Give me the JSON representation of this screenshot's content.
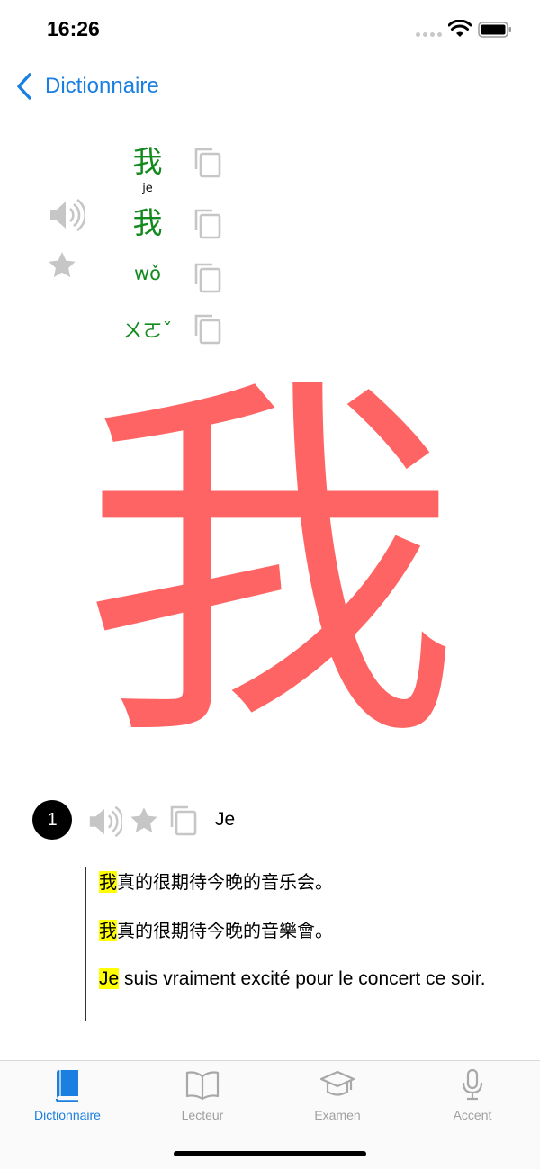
{
  "status_bar": {
    "time": "16:26"
  },
  "nav": {
    "back_label": "Dictionnaire"
  },
  "headword": {
    "simplified": "我",
    "gloss_small": "je",
    "traditional": "我",
    "pinyin": "wǒ",
    "zhuyin": "ㄨㄛˇ"
  },
  "stroke_character": "我",
  "sense": {
    "number": "1",
    "gloss": "Je",
    "examples": [
      {
        "highlight": "我",
        "rest": "真的很期待今晚的音乐会。"
      },
      {
        "highlight": "我",
        "rest": "真的很期待今晚的音樂會。"
      },
      {
        "highlight": "Je",
        "rest": " suis vraiment excité pour le concert ce soir."
      }
    ]
  },
  "tabs": [
    {
      "label": "Dictionnaire",
      "icon": "book-icon",
      "active": true
    },
    {
      "label": "Lecteur",
      "icon": "open-book-icon",
      "active": false
    },
    {
      "label": "Examen",
      "icon": "graduation-cap-icon",
      "active": false
    },
    {
      "label": "Accent",
      "icon": "microphone-icon",
      "active": false
    }
  ],
  "colors": {
    "accent": "#1a7fe0",
    "headword_green": "#138a1d",
    "stroke_red": "#ff2828",
    "highlight": "#ffff00",
    "inactive_icon": "#c4c4c4"
  }
}
